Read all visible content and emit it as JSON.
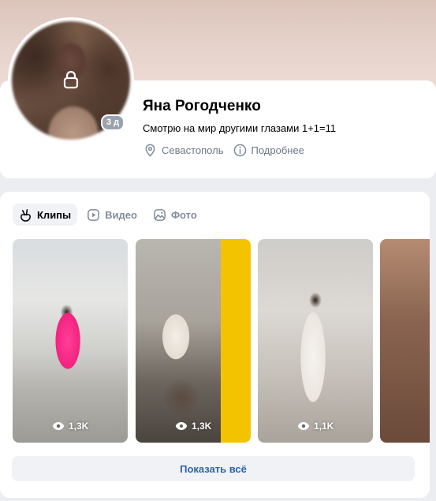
{
  "profile": {
    "name": "Яна Рогодченко",
    "status": "Смотрю на мир другими глазами 1+1=11",
    "last_seen_badge": "3 д",
    "city": "Севастополь",
    "more_info": "Подробнее"
  },
  "media": {
    "tabs": [
      {
        "label": "Клипы",
        "icon": "clips-icon",
        "active": true
      },
      {
        "label": "Видео",
        "icon": "video-icon",
        "active": false
      },
      {
        "label": "Фото",
        "icon": "photo-icon",
        "active": false
      }
    ],
    "clips": [
      {
        "views": "1,3K"
      },
      {
        "views": "1,3K"
      },
      {
        "views": "1,1K"
      },
      {
        "views": ""
      }
    ],
    "show_all_label": "Показать всё"
  },
  "colors": {
    "accent_link": "#2d64b4",
    "secondary_text": "#6d7885",
    "badge_bg": "#99a2ad"
  }
}
